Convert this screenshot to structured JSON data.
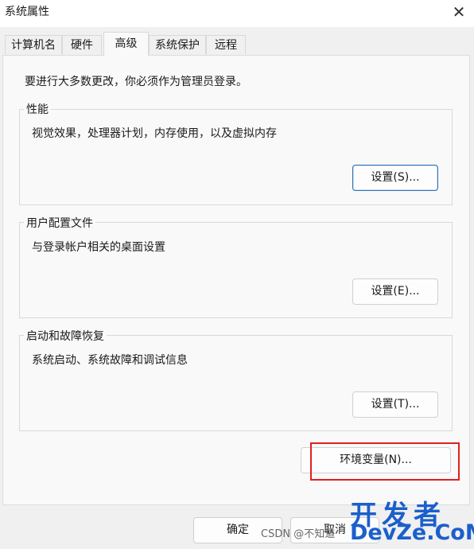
{
  "window": {
    "title": "系统属性",
    "close_glyph": "✕"
  },
  "tabs": [
    {
      "label": "计算机名",
      "active": false
    },
    {
      "label": "硬件",
      "active": false
    },
    {
      "label": "高级",
      "active": true
    },
    {
      "label": "系统保护",
      "active": false
    },
    {
      "label": "远程",
      "active": false
    }
  ],
  "intro": "要进行大多数更改，你必须作为管理员登录。",
  "groups": {
    "performance": {
      "title": "性能",
      "description": "视觉效果，处理器计划，内存使用，以及虚拟内存",
      "button": "设置(S)..."
    },
    "profile": {
      "title": "用户配置文件",
      "description": "与登录帐户相关的桌面设置",
      "button": "设置(E)..."
    },
    "startup": {
      "title": "启动和故障恢复",
      "description": "系统启动、系统故障和调试信息",
      "button": "设置(T)..."
    }
  },
  "env_button": "环境变量(N)...",
  "footer": {
    "ok": "确定",
    "cancel": "取消"
  },
  "watermark": {
    "main": "开发者",
    "sub": "DevZe.CoM",
    "csdn": "CSDN @不知道"
  },
  "colors": {
    "highlight_box": "#e02020",
    "focus_border": "#2e6fb8",
    "watermark": "#1b5fcc"
  }
}
